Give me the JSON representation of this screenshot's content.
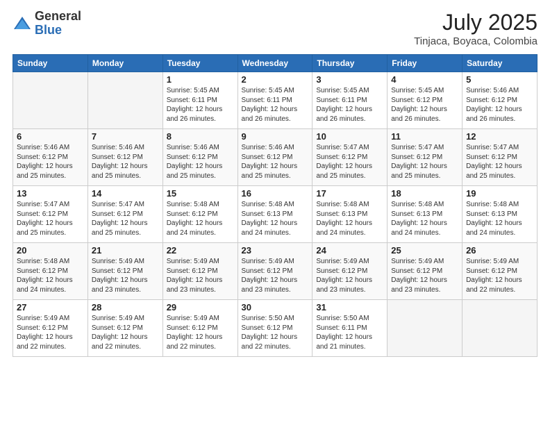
{
  "header": {
    "logo_general": "General",
    "logo_blue": "Blue",
    "month_title": "July 2025",
    "location": "Tinjaca, Boyaca, Colombia"
  },
  "weekdays": [
    "Sunday",
    "Monday",
    "Tuesday",
    "Wednesday",
    "Thursday",
    "Friday",
    "Saturday"
  ],
  "weeks": [
    [
      {
        "day": "",
        "detail": ""
      },
      {
        "day": "",
        "detail": ""
      },
      {
        "day": "1",
        "detail": "Sunrise: 5:45 AM\nSunset: 6:11 PM\nDaylight: 12 hours\nand 26 minutes."
      },
      {
        "day": "2",
        "detail": "Sunrise: 5:45 AM\nSunset: 6:11 PM\nDaylight: 12 hours\nand 26 minutes."
      },
      {
        "day": "3",
        "detail": "Sunrise: 5:45 AM\nSunset: 6:11 PM\nDaylight: 12 hours\nand 26 minutes."
      },
      {
        "day": "4",
        "detail": "Sunrise: 5:45 AM\nSunset: 6:12 PM\nDaylight: 12 hours\nand 26 minutes."
      },
      {
        "day": "5",
        "detail": "Sunrise: 5:46 AM\nSunset: 6:12 PM\nDaylight: 12 hours\nand 26 minutes."
      }
    ],
    [
      {
        "day": "6",
        "detail": "Sunrise: 5:46 AM\nSunset: 6:12 PM\nDaylight: 12 hours\nand 25 minutes."
      },
      {
        "day": "7",
        "detail": "Sunrise: 5:46 AM\nSunset: 6:12 PM\nDaylight: 12 hours\nand 25 minutes."
      },
      {
        "day": "8",
        "detail": "Sunrise: 5:46 AM\nSunset: 6:12 PM\nDaylight: 12 hours\nand 25 minutes."
      },
      {
        "day": "9",
        "detail": "Sunrise: 5:46 AM\nSunset: 6:12 PM\nDaylight: 12 hours\nand 25 minutes."
      },
      {
        "day": "10",
        "detail": "Sunrise: 5:47 AM\nSunset: 6:12 PM\nDaylight: 12 hours\nand 25 minutes."
      },
      {
        "day": "11",
        "detail": "Sunrise: 5:47 AM\nSunset: 6:12 PM\nDaylight: 12 hours\nand 25 minutes."
      },
      {
        "day": "12",
        "detail": "Sunrise: 5:47 AM\nSunset: 6:12 PM\nDaylight: 12 hours\nand 25 minutes."
      }
    ],
    [
      {
        "day": "13",
        "detail": "Sunrise: 5:47 AM\nSunset: 6:12 PM\nDaylight: 12 hours\nand 25 minutes."
      },
      {
        "day": "14",
        "detail": "Sunrise: 5:47 AM\nSunset: 6:12 PM\nDaylight: 12 hours\nand 25 minutes."
      },
      {
        "day": "15",
        "detail": "Sunrise: 5:48 AM\nSunset: 6:12 PM\nDaylight: 12 hours\nand 24 minutes."
      },
      {
        "day": "16",
        "detail": "Sunrise: 5:48 AM\nSunset: 6:13 PM\nDaylight: 12 hours\nand 24 minutes."
      },
      {
        "day": "17",
        "detail": "Sunrise: 5:48 AM\nSunset: 6:13 PM\nDaylight: 12 hours\nand 24 minutes."
      },
      {
        "day": "18",
        "detail": "Sunrise: 5:48 AM\nSunset: 6:13 PM\nDaylight: 12 hours\nand 24 minutes."
      },
      {
        "day": "19",
        "detail": "Sunrise: 5:48 AM\nSunset: 6:13 PM\nDaylight: 12 hours\nand 24 minutes."
      }
    ],
    [
      {
        "day": "20",
        "detail": "Sunrise: 5:48 AM\nSunset: 6:12 PM\nDaylight: 12 hours\nand 24 minutes."
      },
      {
        "day": "21",
        "detail": "Sunrise: 5:49 AM\nSunset: 6:12 PM\nDaylight: 12 hours\nand 23 minutes."
      },
      {
        "day": "22",
        "detail": "Sunrise: 5:49 AM\nSunset: 6:12 PM\nDaylight: 12 hours\nand 23 minutes."
      },
      {
        "day": "23",
        "detail": "Sunrise: 5:49 AM\nSunset: 6:12 PM\nDaylight: 12 hours\nand 23 minutes."
      },
      {
        "day": "24",
        "detail": "Sunrise: 5:49 AM\nSunset: 6:12 PM\nDaylight: 12 hours\nand 23 minutes."
      },
      {
        "day": "25",
        "detail": "Sunrise: 5:49 AM\nSunset: 6:12 PM\nDaylight: 12 hours\nand 23 minutes."
      },
      {
        "day": "26",
        "detail": "Sunrise: 5:49 AM\nSunset: 6:12 PM\nDaylight: 12 hours\nand 22 minutes."
      }
    ],
    [
      {
        "day": "27",
        "detail": "Sunrise: 5:49 AM\nSunset: 6:12 PM\nDaylight: 12 hours\nand 22 minutes."
      },
      {
        "day": "28",
        "detail": "Sunrise: 5:49 AM\nSunset: 6:12 PM\nDaylight: 12 hours\nand 22 minutes."
      },
      {
        "day": "29",
        "detail": "Sunrise: 5:49 AM\nSunset: 6:12 PM\nDaylight: 12 hours\nand 22 minutes."
      },
      {
        "day": "30",
        "detail": "Sunrise: 5:50 AM\nSunset: 6:12 PM\nDaylight: 12 hours\nand 22 minutes."
      },
      {
        "day": "31",
        "detail": "Sunrise: 5:50 AM\nSunset: 6:11 PM\nDaylight: 12 hours\nand 21 minutes."
      },
      {
        "day": "",
        "detail": ""
      },
      {
        "day": "",
        "detail": ""
      }
    ]
  ]
}
